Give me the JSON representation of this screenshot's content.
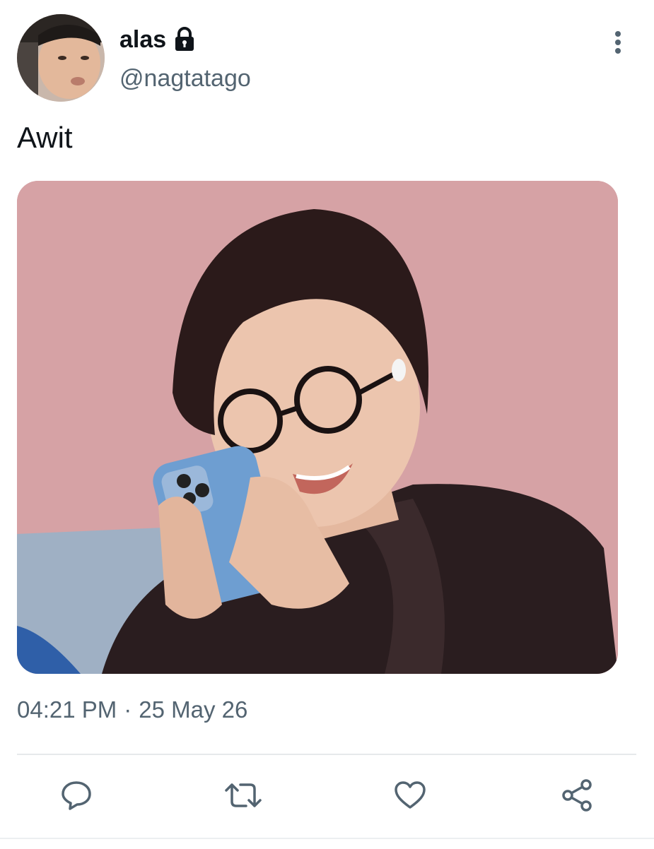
{
  "user": {
    "display_name": "alas",
    "handle": "@nagtatago",
    "protected_icon": "lock-icon",
    "avatar_icon": "profile-photo"
  },
  "tweet": {
    "text": "Awit",
    "time": "04:21 PM",
    "separator": "·",
    "date": "25 May 26"
  },
  "actions": {
    "reply_icon": "reply-icon",
    "retweet_icon": "retweet-icon",
    "like_icon": "heart-icon",
    "share_icon": "share-icon",
    "more_icon": "more-vertical-icon"
  },
  "colors": {
    "text_primary": "#0f1419",
    "text_secondary": "#536471",
    "divider": "#e6e9eb",
    "media_background": "#d6a2a5"
  }
}
